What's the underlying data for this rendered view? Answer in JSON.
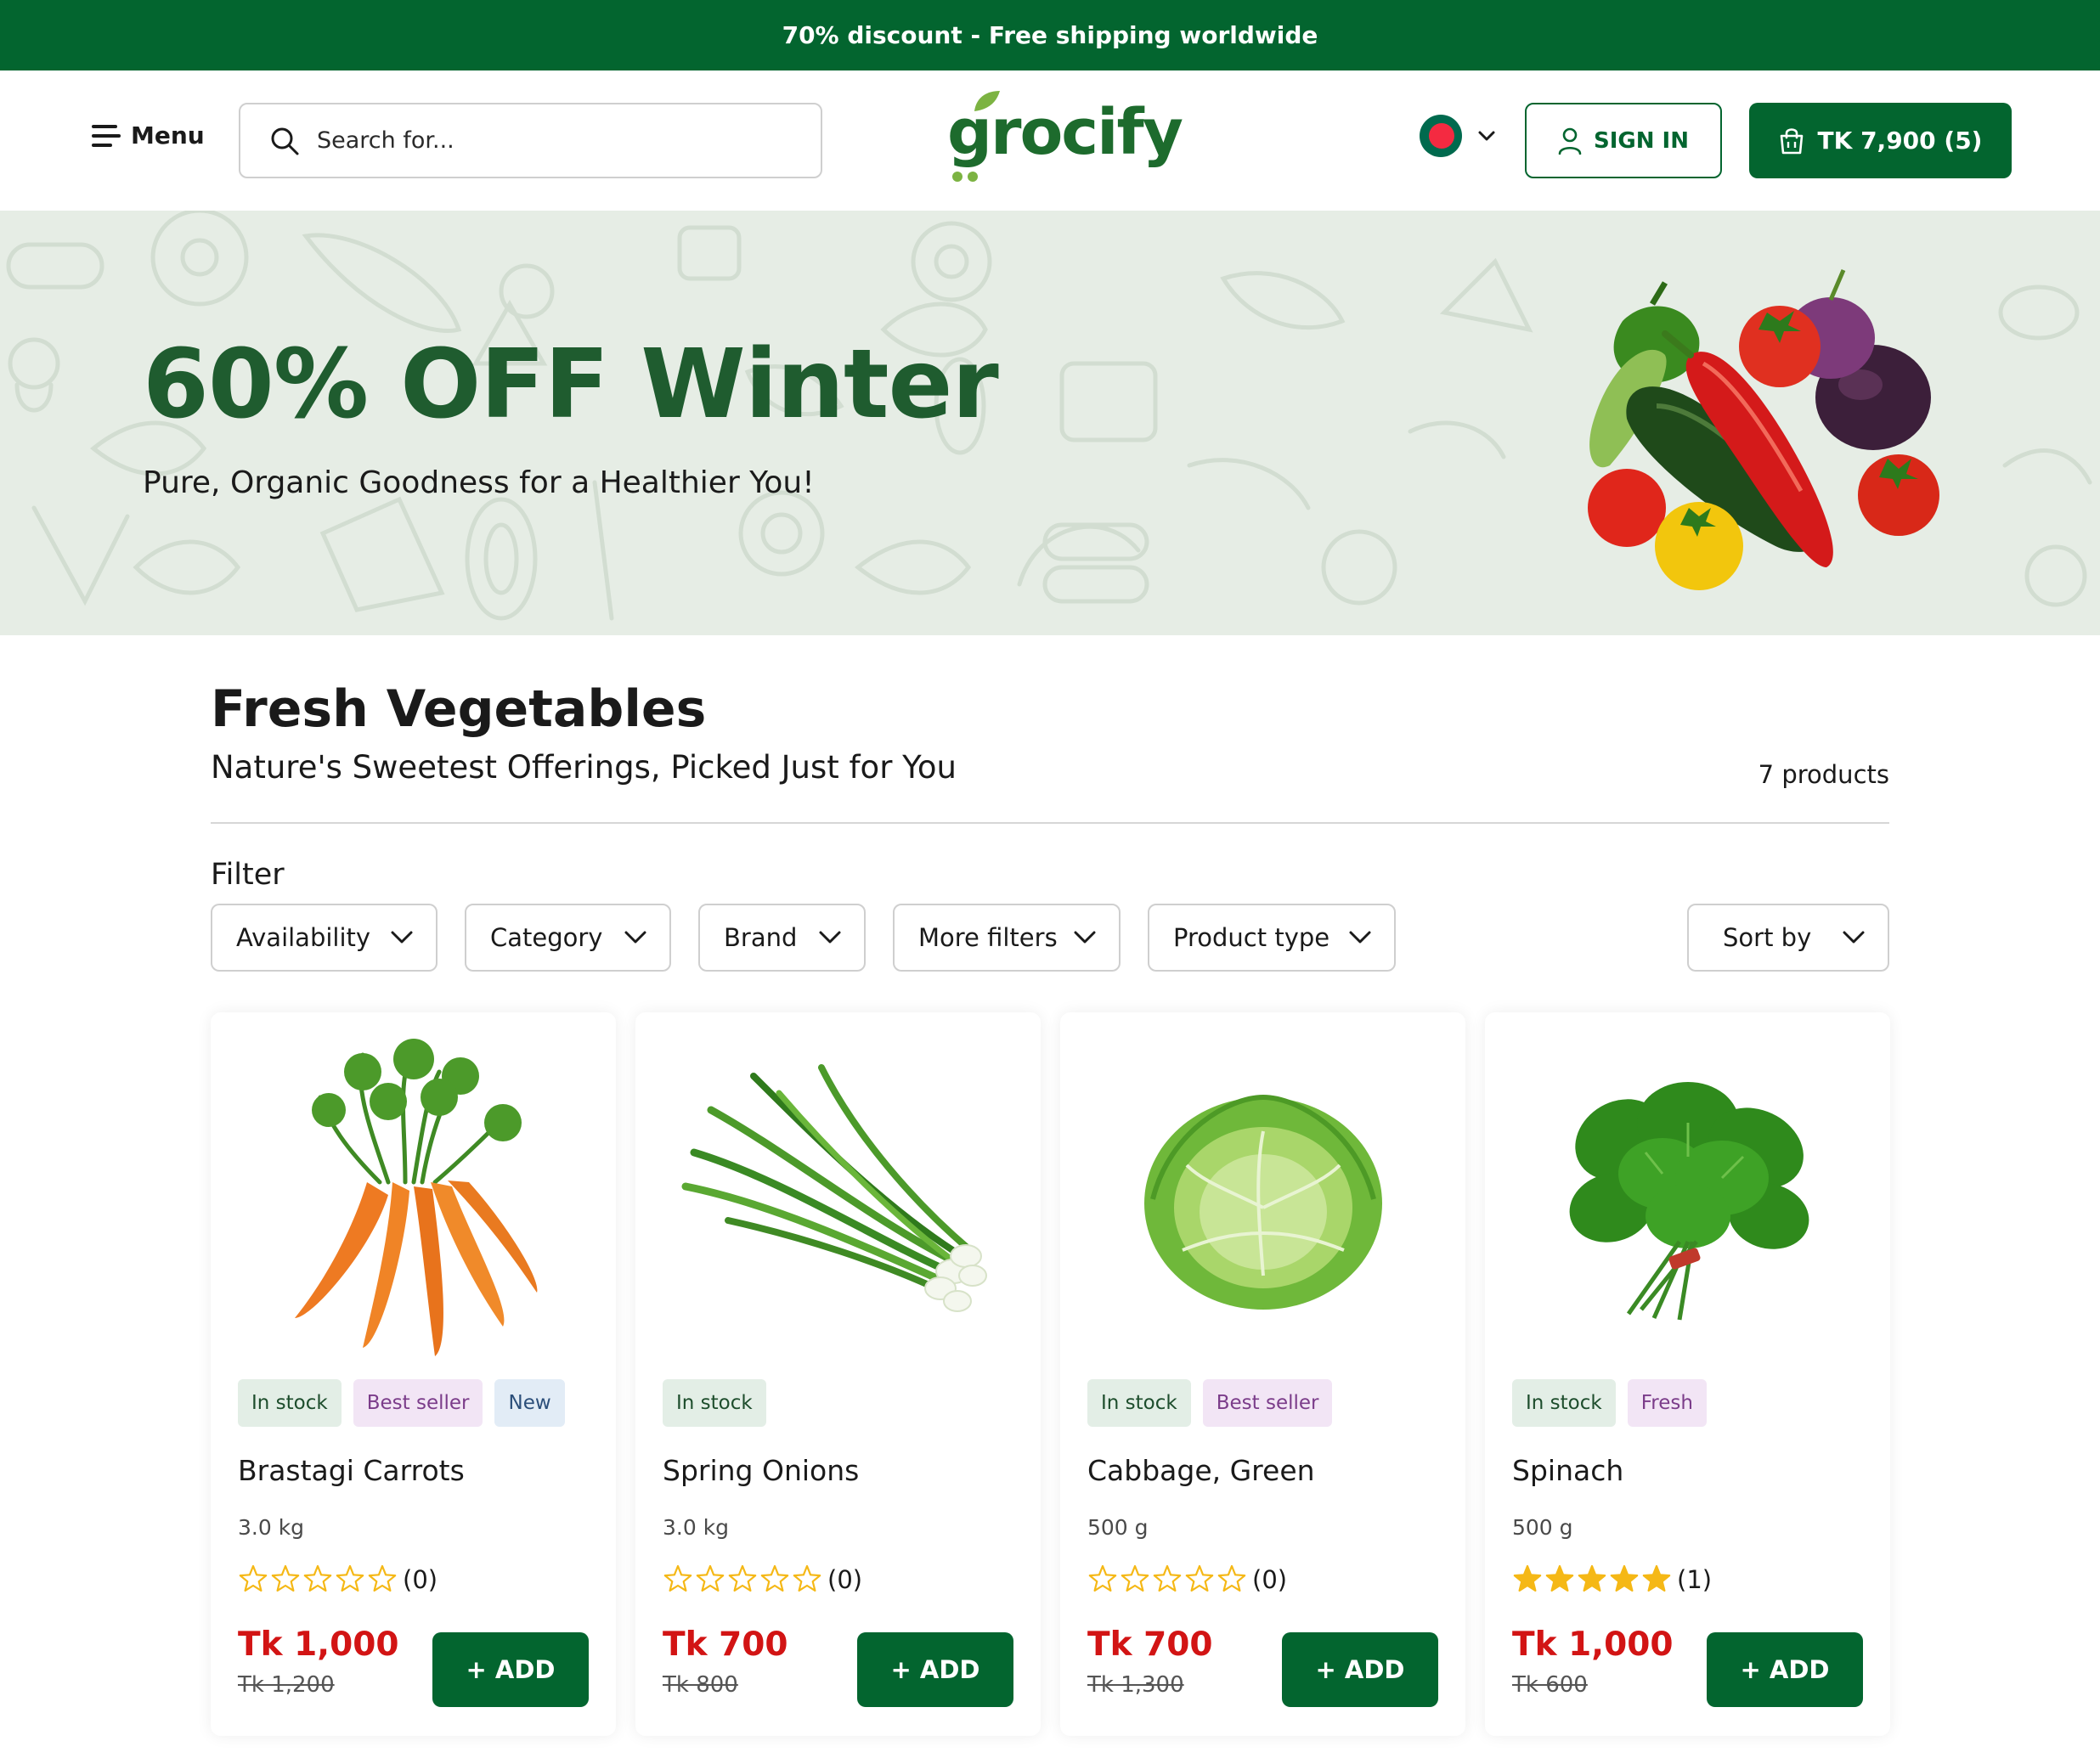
{
  "announcement": "70% discount - Free shipping worldwide",
  "header": {
    "menu_label": "Menu",
    "search_placeholder": "Search for...",
    "logo": "grocify",
    "signin_label": "SIGN IN",
    "cart_label": "TK 7,900 (5)"
  },
  "hero": {
    "title": "60% OFF Winter",
    "subtitle": "Pure, Organic Goodness for a Healthier You!"
  },
  "section": {
    "title": "Fresh Vegetables",
    "subtitle": "Nature's Sweetest Offerings, Picked Just for You",
    "count": "7 products"
  },
  "filters": {
    "label": "Filter",
    "items": [
      "Availability",
      "Category",
      "Brand",
      "More filters",
      "Product type"
    ],
    "sort_label": "Sort by"
  },
  "products": [
    {
      "name": "Brastagi Carrots",
      "weight": "3.0 kg",
      "badges": [
        "In stock",
        "Best seller",
        "New"
      ],
      "rating": 0,
      "reviews": "(0)",
      "price": "Tk 1,000",
      "old_price": "Tk 1,200",
      "add_label": "+ ADD"
    },
    {
      "name": "Spring Onions",
      "weight": "3.0 kg",
      "badges": [
        "In stock"
      ],
      "rating": 0,
      "reviews": "(0)",
      "price": "Tk 700",
      "old_price": "Tk 800",
      "add_label": "+ ADD"
    },
    {
      "name": "Cabbage, Green",
      "weight": "500 g",
      "badges": [
        "In stock",
        "Best seller"
      ],
      "rating": 0,
      "reviews": "(0)",
      "price": "Tk 700",
      "old_price": "Tk 1,300",
      "add_label": "+ ADD"
    },
    {
      "name": "Spinach",
      "weight": "500 g",
      "badges": [
        "In stock",
        "Fresh"
      ],
      "rating": 5,
      "reviews": "(1)",
      "price": "Tk 1,000",
      "old_price": "Tk 600",
      "add_label": "+ ADD"
    }
  ],
  "colors": {
    "brand_green": "#03652f",
    "price_red": "#d21414",
    "star_gold": "#f5b816",
    "hero_bg": "#e6ede5"
  }
}
